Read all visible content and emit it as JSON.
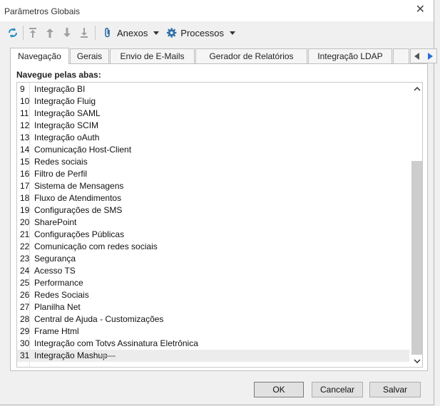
{
  "window": {
    "title": "Parâmetros Globais"
  },
  "toolbar": {
    "attachments_label": "Anexos",
    "processes_label": "Processos"
  },
  "tabs": [
    {
      "label": "Navegação",
      "active": true
    },
    {
      "label": "Gerais",
      "active": false
    },
    {
      "label": "Envio de E-Mails",
      "active": false
    },
    {
      "label": "Gerador de Relatórios",
      "active": false
    },
    {
      "label": "Integração LDAP",
      "active": false
    }
  ],
  "panel": {
    "label": "Navegue pelas abas:"
  },
  "list": {
    "items": [
      {
        "num": "9",
        "label": "Integração BI"
      },
      {
        "num": "10",
        "label": "Integração Fluig"
      },
      {
        "num": "11",
        "label": "Integração SAML"
      },
      {
        "num": "12",
        "label": "Integração SCIM"
      },
      {
        "num": "13",
        "label": "Integração oAuth"
      },
      {
        "num": "14",
        "label": "Comunicação Host-Client"
      },
      {
        "num": "15",
        "label": "Redes sociais"
      },
      {
        "num": "16",
        "label": "Filtro de Perfil"
      },
      {
        "num": "17",
        "label": "Sistema de Mensagens"
      },
      {
        "num": "18",
        "label": "Fluxo de Atendimentos"
      },
      {
        "num": "19",
        "label": "Configurações de SMS"
      },
      {
        "num": "20",
        "label": "SharePoint"
      },
      {
        "num": "21",
        "label": "Configurações Públicas"
      },
      {
        "num": "22",
        "label": "Comunicação com redes sociais"
      },
      {
        "num": "23",
        "label": "Segurança"
      },
      {
        "num": "24",
        "label": "Acesso TS"
      },
      {
        "num": "25",
        "label": "Performance"
      },
      {
        "num": "26",
        "label": "Redes Sociais"
      },
      {
        "num": "27",
        "label": "Planilha Net"
      },
      {
        "num": "28",
        "label": "Central de Ajuda - Customizações"
      },
      {
        "num": "29",
        "label": "Frame Html"
      },
      {
        "num": "30",
        "label": "Integração com Totvs Assinatura Eletrônica"
      },
      {
        "num": "31",
        "label": "Integração Mashup"
      }
    ]
  },
  "buttons": {
    "ok": "OK",
    "cancel": "Cancelar",
    "save": "Salvar"
  }
}
